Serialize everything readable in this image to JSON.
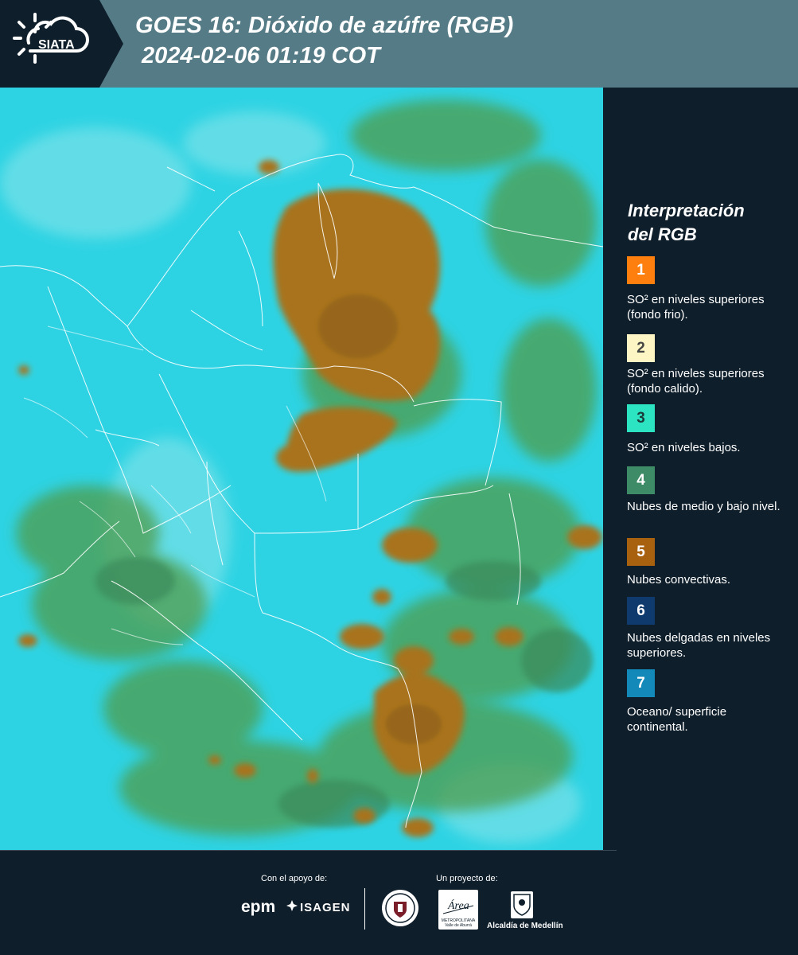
{
  "header": {
    "logo_text": "SIATA",
    "title_line1": "GOES 16: Dióxido de azúfre (RGB)",
    "title_line2": "2024-02-06 01:19 COT"
  },
  "legend": {
    "title_line1": "Interpretación",
    "title_line2": "del RGB",
    "items": [
      {
        "number": "1",
        "color": "#ff7f0e",
        "text_color": "#ffffff",
        "label": "SO² en niveles superiores (fondo frio)."
      },
      {
        "number": "2",
        "color": "#fdf5c3",
        "text_color": "#444444",
        "label": "SO² en niveles superiores (fondo calido)."
      },
      {
        "number": "3",
        "color": "#2de4c2",
        "text_color": "#1b3b3b",
        "label": "SO² en niveles bajos."
      },
      {
        "number": "4",
        "color": "#3d8c67",
        "text_color": "#ffffff",
        "label": "Nubes de medio y bajo nivel."
      },
      {
        "number": "5",
        "color": "#a8610e",
        "text_color": "#ffffff",
        "label": "Nubes convectivas."
      },
      {
        "number": "6",
        "color": "#0e3a6e",
        "text_color": "#ffffff",
        "label": "Nubes delgadas en niveles superiores."
      },
      {
        "number": "7",
        "color": "#1289b8",
        "text_color": "#ffffff",
        "label": "Oceano/ superficie continental."
      }
    ]
  },
  "footer": {
    "support_label": "Con el apoyo de:",
    "project_label": "Un proyecto de:",
    "sponsor1": "epm",
    "sponsor2": "ISAGEN",
    "area_name": "Área",
    "area_sub": "METROPOLITANA Valle de Aburrá",
    "alcaldia": "Alcaldía de Medellín"
  },
  "colors": {
    "background": "#0e1e2b",
    "header_bar": "#557b86",
    "sea_cyan": "#2ed3e3",
    "convective_brown": "#a8731f",
    "low_cloud_green": "#4f9c4c"
  }
}
